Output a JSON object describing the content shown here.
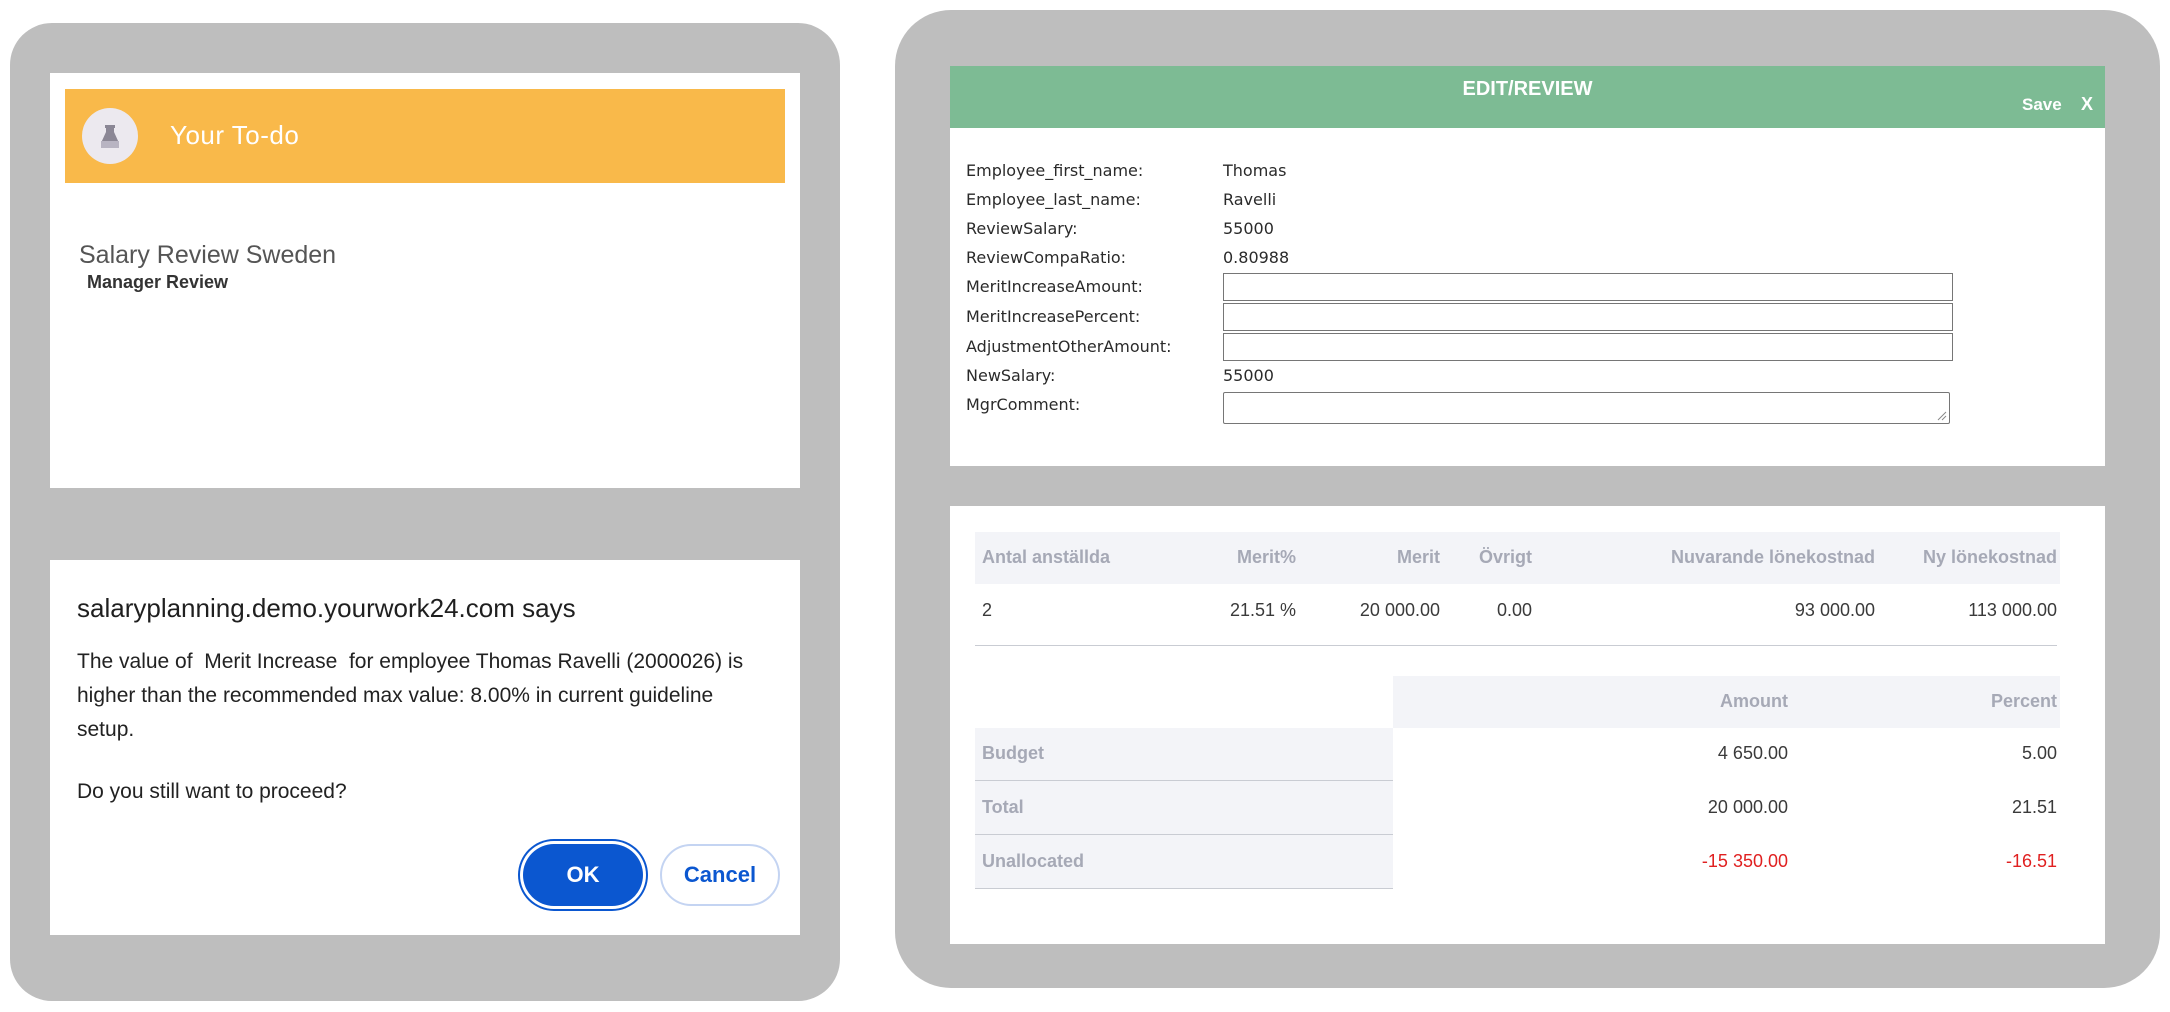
{
  "todo": {
    "header_title": "Your To-do",
    "item_title": "Salary Review Sweden",
    "item_subtitle": "Manager Review"
  },
  "dialog": {
    "title": "salaryplanning.demo.yourwork24.com says",
    "message_line1": "The value of  Merit Increase  for employee Thomas Ravelli (2000026) is",
    "message_line2": "higher than the recommended max value: 8.00% in current guideline",
    "message_line3": "setup.",
    "question": "Do you still want to proceed?",
    "ok_label": "OK",
    "cancel_label": "Cancel",
    "primary_color": "#0b57d0"
  },
  "edit": {
    "title": "EDIT/REVIEW",
    "save_label": "Save",
    "close_label": "X",
    "header_color": "#7dbb94",
    "fields": [
      {
        "label": "Employee_first_name:",
        "value": "Thomas"
      },
      {
        "label": "Employee_last_name:",
        "value": "Ravelli"
      },
      {
        "label": "ReviewSalary:",
        "value": "55000"
      },
      {
        "label": "ReviewCompaRatio:",
        "value": "0.80988"
      },
      {
        "label": "MeritIncreaseAmount:",
        "value": ""
      },
      {
        "label": "MeritIncreasePercent:",
        "value": ""
      },
      {
        "label": "AdjustmentOtherAmount:",
        "value": ""
      },
      {
        "label": "NewSalary:",
        "value": "55000"
      },
      {
        "label": "MgrComment:",
        "value": ""
      }
    ]
  },
  "summary": {
    "headers": [
      "Antal anställda",
      "Merit%",
      "Merit",
      "Övrigt",
      "Nuvarande lönekostnad",
      "Ny lönekostnad"
    ],
    "row": [
      "2",
      "21.51 %",
      "20 000.00",
      "0.00",
      "93 000.00",
      "113 000.00"
    ],
    "budget_headers": [
      "Amount",
      "Percent"
    ],
    "budget_rows": [
      {
        "label": "Budget",
        "amount": "4 650.00",
        "percent": "5.00"
      },
      {
        "label": "Total",
        "amount": "20 000.00",
        "percent": "21.51"
      },
      {
        "label": "Unallocated",
        "amount": "-15 350.00",
        "percent": "-16.51"
      }
    ],
    "negative_color": "#e02020"
  },
  "colors": {
    "todo_header": "#f9b94a",
    "panel_bg": "#bebebe"
  }
}
